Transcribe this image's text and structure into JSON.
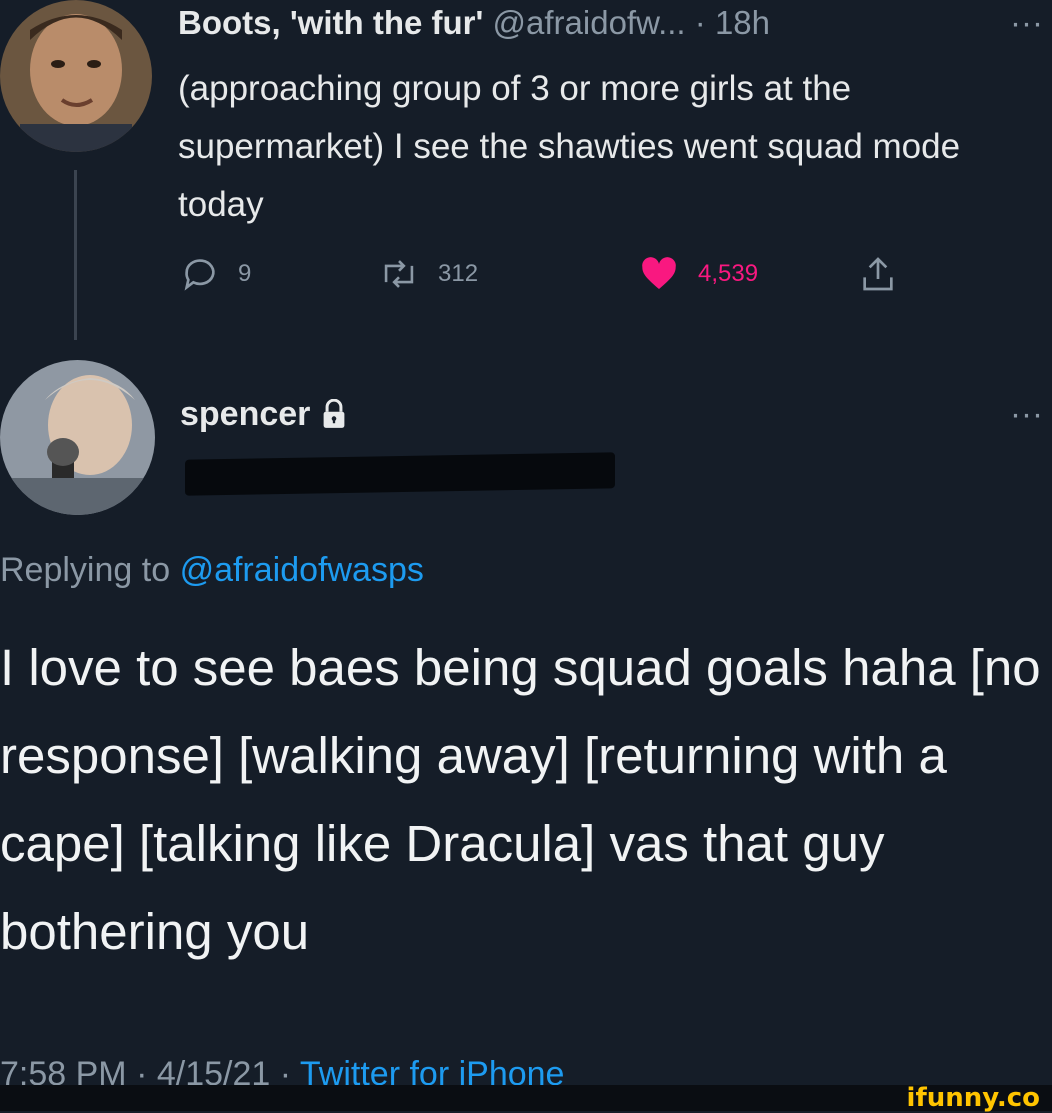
{
  "tweet1": {
    "display_name": "Boots, 'with the fur'",
    "handle": "@afraidofw...",
    "separator": "·",
    "time": "18h",
    "more": "···",
    "text": "(approaching group of 3 or more girls at the supermarket) I see the shawties went squad mode today",
    "replies": "9",
    "retweets": "312",
    "likes": "4,539",
    "liked": true
  },
  "tweet2": {
    "display_name": "spencer",
    "protected_icon": "lock-icon",
    "more": "···",
    "replying_prefix": "Replying to",
    "replying_handle": "@afraidofwasps",
    "text": "I love to see baes being squad goals haha [no response] [walking away] [returning with a cape] [talking like Dracula] vas that guy bothering you",
    "time": "7:58 PM",
    "dot1": " · ",
    "date": "4/15/21",
    "dot2": " · ",
    "client": "Twitter for iPhone"
  },
  "watermark": "ifunny.co",
  "colors": {
    "background": "#151d28",
    "text": "#e7e9ea",
    "muted": "#8b98a5",
    "link": "#1d9bf0",
    "like": "#f91880",
    "watermark": "#ffc400"
  },
  "icons": [
    "reply-icon",
    "retweet-icon",
    "heart-icon",
    "share-icon",
    "lock-icon"
  ]
}
